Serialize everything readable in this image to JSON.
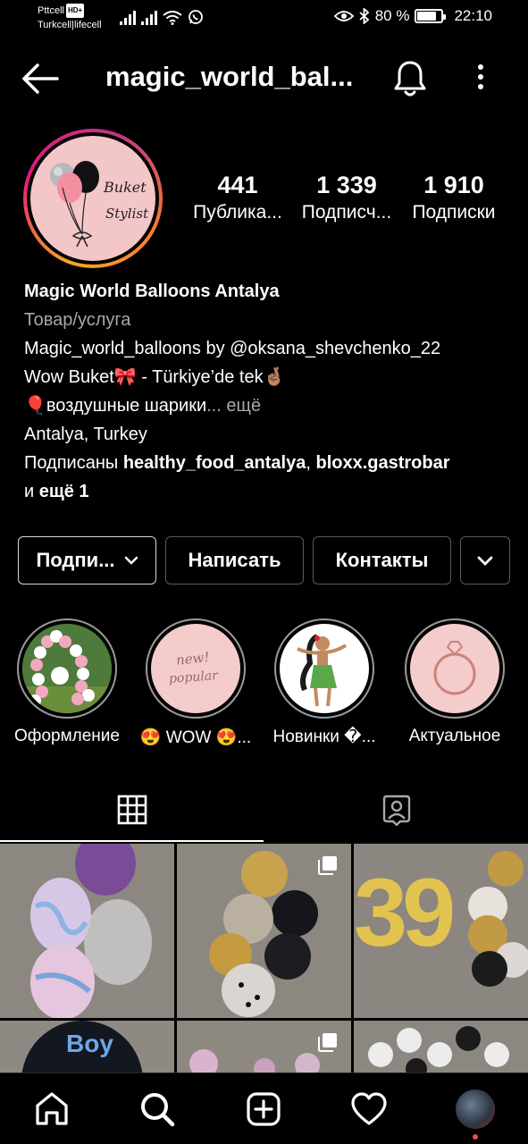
{
  "status_bar": {
    "carrier1": "Pttcell",
    "carrier1_badge": "HD+",
    "carrier2": "Turkcell|lifecell",
    "battery_percent": "80 %",
    "battery_level": 0.8,
    "time": "22:10"
  },
  "header": {
    "username": "magic_world_bal...",
    "back_icon": "arrow-left-icon",
    "bell_icon": "bell-icon",
    "more_icon": "more-vertical-icon"
  },
  "profile": {
    "avatar_text_1": "Buket",
    "avatar_text_2": "Stylist",
    "stats": [
      {
        "num": "441",
        "label": "Публика..."
      },
      {
        "num": "1 339",
        "label": "Подписч..."
      },
      {
        "num": "1 910",
        "label": "Подписки"
      }
    ],
    "name": "Magic World Balloons Antalya",
    "category": "Товар/услуга",
    "bio_line1": "Magic_world_balloons by @oksana_shevchenko_22",
    "bio_line2": "Wow Buket🎀 - Türkiye’de tek🤞🏽",
    "bio_line3": "🎈воздушные шарики",
    "bio_more": "... ещё",
    "location": "Antalya, Turkey",
    "followed_by_prefix": "Подписаны ",
    "followed_by_1": "healthy_food_antalya",
    "followed_by_sep": ", ",
    "followed_by_2": "bloxx.gastrobar",
    "followed_by_and": "и ",
    "followed_by_more": "ещё 1"
  },
  "actions": {
    "follow_label": "Подпи...",
    "message_label": "Написать",
    "contacts_label": "Контакты"
  },
  "highlights": [
    {
      "label": "Оформление"
    },
    {
      "label": "😍 WOW 😍..."
    },
    {
      "label": "Новинки �..."
    },
    {
      "label": "Актуальное"
    }
  ],
  "highlight_texts": {
    "new": "new!",
    "popular": "popular"
  },
  "tabs": {
    "grid_icon": "grid-icon",
    "tagged_icon": "tagged-person-icon"
  },
  "posts": [
    {
      "caption": ""
    },
    {
      "caption": ""
    },
    {
      "caption": "39"
    },
    {
      "caption": "Boy"
    },
    {
      "caption": ""
    },
    {
      "caption": ""
    }
  ],
  "bottom_nav": [
    "home-icon",
    "search-icon",
    "add-post-icon",
    "heart-icon",
    "profile-avatar"
  ],
  "colors": {
    "background": "#000000",
    "text_secondary": "#a8a8a8",
    "button_border": "#5a5a5a",
    "avatar_bg": "#f3c6c8",
    "notification_dot": "#ed4956"
  }
}
